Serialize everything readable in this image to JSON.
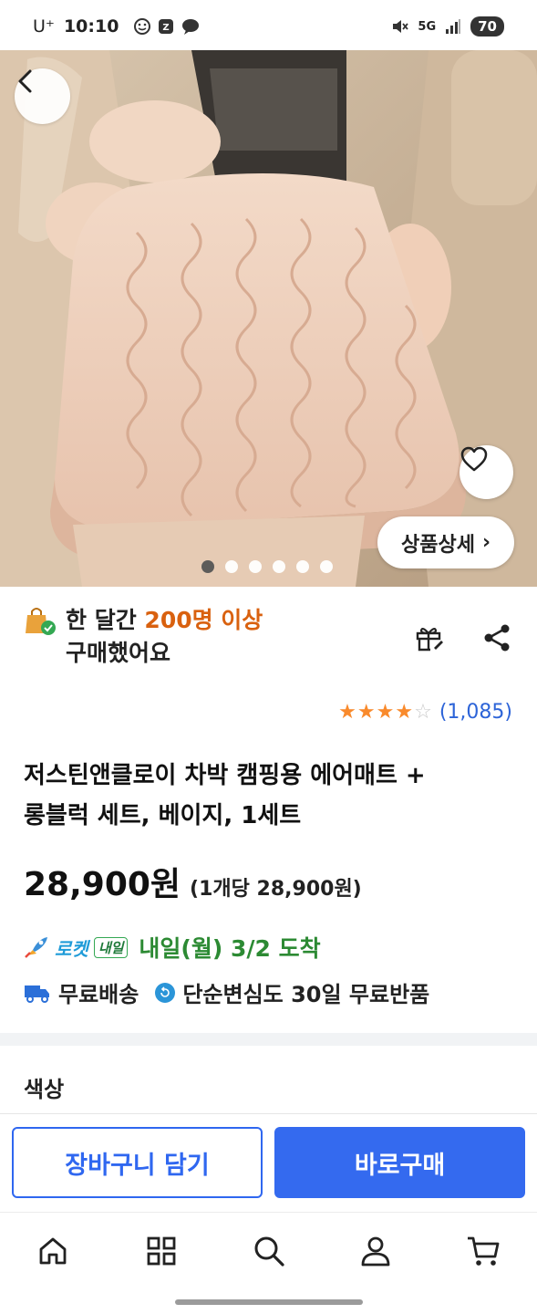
{
  "status_bar": {
    "carrier": "U⁺",
    "time": "10:10",
    "network": "5G",
    "battery": "70"
  },
  "hero": {
    "detail_label": "상품상세",
    "detail_chevron": "›",
    "image_count": 6,
    "active_image_index": 0
  },
  "purchase": {
    "prefix": "한 달간 ",
    "highlight": "200명 이상",
    "suffix": "구매했어요"
  },
  "rating": {
    "stars": 4,
    "max_stars": 5,
    "review_count": "(1,085)"
  },
  "product": {
    "title_line1": "저스틴앤클로이 차박 캠핑용 에어매트 +",
    "title_line2": "롱블럭 세트, 베이지, 1세트",
    "price": "28,900원",
    "unit_price": "(1개당 28,900원)"
  },
  "delivery": {
    "rocket_label": "로켓",
    "naeil_badge": "내일",
    "arrival": "내일(월) 3/2 도착",
    "free_shipping": "무료배송",
    "free_return": "단순변심도 30일 무료반품"
  },
  "options": {
    "color_label": "색상"
  },
  "cta": {
    "cart": "장바구니 담기",
    "buy": "바로구매"
  },
  "nav": {
    "items": [
      "home-icon",
      "category-icon",
      "search-icon",
      "my-page-icon",
      "cart-icon"
    ]
  },
  "colors": {
    "accent_blue": "#346aef",
    "highlight_orange": "#d9610f",
    "arrival_green": "#2c8a33",
    "star_orange": "#f98a2c"
  }
}
